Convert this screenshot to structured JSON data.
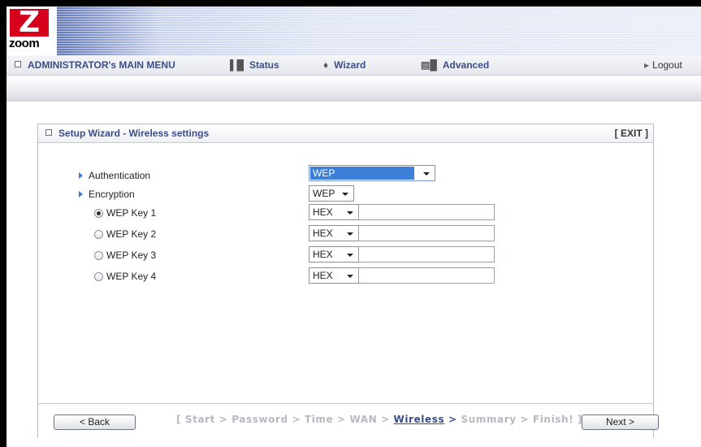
{
  "logo": {
    "letter": "Z",
    "text": "zoom"
  },
  "nav": {
    "main_menu": "ADMINISTRATOR's MAIN MENU",
    "status": "Status",
    "wizard": "Wizard",
    "advanced": "Advanced",
    "logout": "Logout"
  },
  "icons": {
    "status": "status-icon",
    "wizard": "wizard-icon",
    "advanced": "advanced-icon"
  },
  "panel": {
    "title": "Setup Wizard - Wireless settings",
    "exit": "[ EXIT ]"
  },
  "form": {
    "authentication": {
      "label": "Authentication",
      "value": "WEP"
    },
    "encryption": {
      "label": "Encryption",
      "value": "WEP"
    },
    "keys": [
      {
        "label": "WEP Key 1",
        "format": "HEX",
        "value": "",
        "selected": true
      },
      {
        "label": "WEP Key 2",
        "format": "HEX",
        "value": "",
        "selected": false
      },
      {
        "label": "WEP Key 3",
        "format": "HEX",
        "value": "",
        "selected": false
      },
      {
        "label": "WEP Key 4",
        "format": "HEX",
        "value": "",
        "selected": false
      }
    ]
  },
  "footer": {
    "back": "< Back",
    "next": "Next >",
    "steps_prefix": "[ Start > Password > Time > WAN > ",
    "steps_active": "Wireless",
    "steps_gt": " > ",
    "steps_suffix": "Summary > Finish! ]"
  },
  "colors": {
    "accent": "#3b4d86",
    "highlight": "#3c7fd8",
    "logo": "#d6001c"
  }
}
